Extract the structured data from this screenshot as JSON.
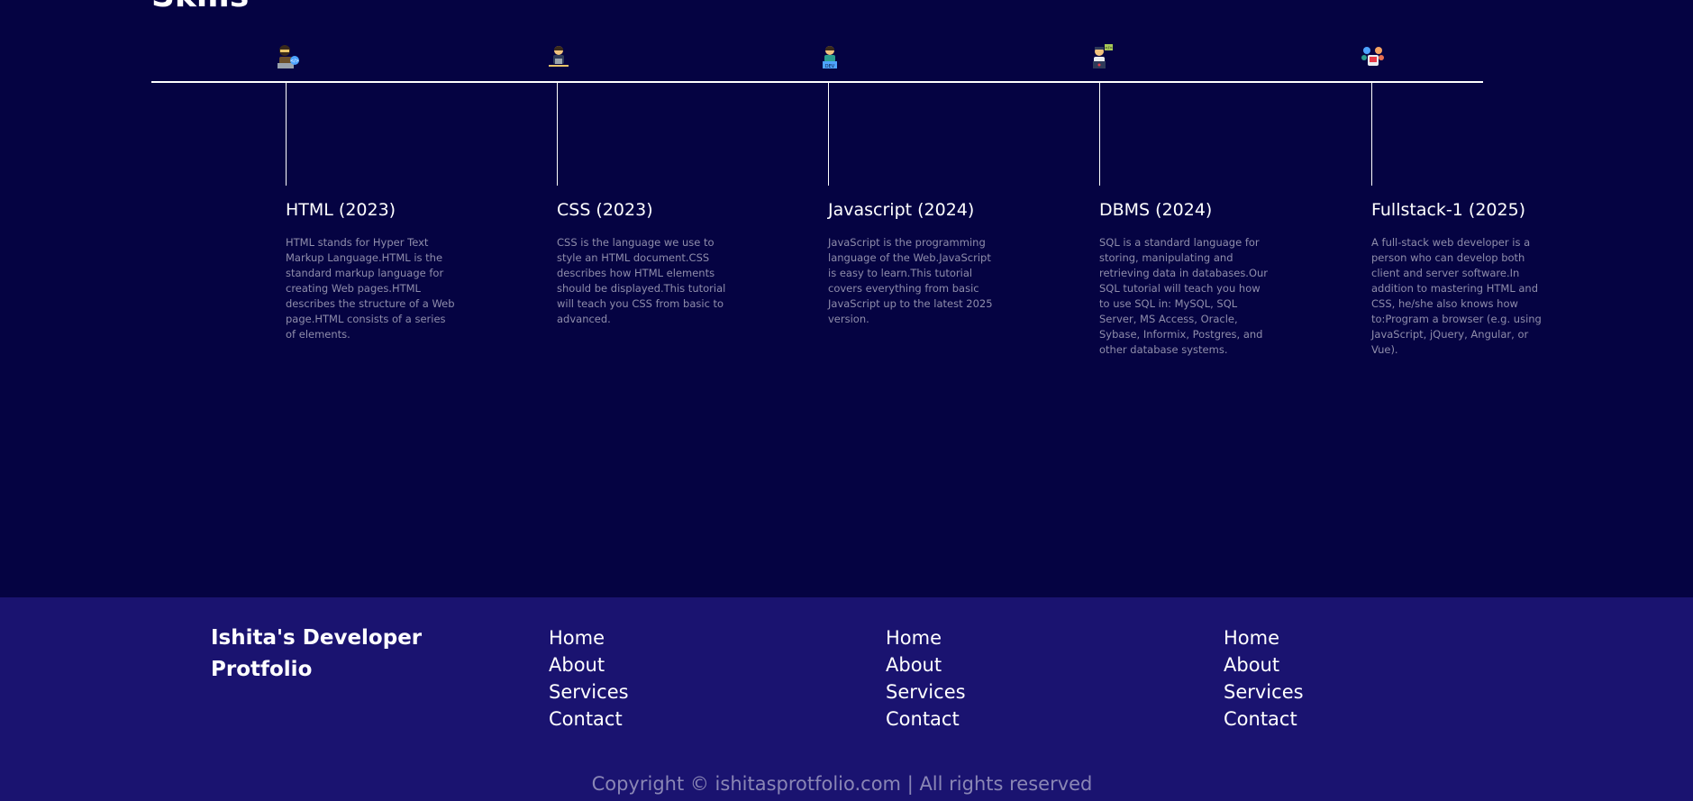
{
  "skills": {
    "title": "Skills",
    "items": [
      {
        "icon": "hacker-laptop-icon",
        "title": "HTML (2023)",
        "description": "HTML stands for Hyper Text Markup Language.HTML is the standard markup language for creating Web pages.HTML describes the structure of a Web page.HTML consists of a series of elements."
      },
      {
        "icon": "programmer-desk-icon",
        "title": "CSS (2023)",
        "description": "CSS is the language we use to style an HTML document.CSS describes how HTML elements should be displayed.This tutorial will teach you CSS from basic to advanced."
      },
      {
        "icon": "developer-dev-icon",
        "title": "Javascript (2024)",
        "description": "JavaScript is the programming language of the Web.JavaScript is easy to learn.This tutorial covers everything from basic JavaScript up to the latest 2025 version."
      },
      {
        "icon": "coder-code-tag-icon",
        "title": "DBMS (2024)",
        "description": "SQL is a standard language for storing, manipulating and retrieving data in databases.Our SQL tutorial will teach you how to use SQL in: MySQL, SQL Server, MS Access, Oracle, Sybase, Informix, Postgres, and other database systems."
      },
      {
        "icon": "fullstack-team-icon",
        "title": "Fullstack-1 (2025)",
        "description": "A full-stack web developer is a person who can develop both client and server software.In addition to mastering HTML and CSS, he/she also knows how to:Program a browser (e.g. using JavaScript, jQuery, Angular, or Vue)."
      }
    ]
  },
  "footer": {
    "brand": "Ishita's Developer Protfolio",
    "columns": [
      {
        "links": [
          "Home",
          "About",
          "Services",
          "Contact"
        ]
      },
      {
        "links": [
          "Home",
          "About",
          "Services",
          "Contact"
        ]
      },
      {
        "links": [
          "Home",
          "About",
          "Services",
          "Contact"
        ]
      }
    ],
    "copyright": "Copyright © ishitasprotfolio.com | All rights reserved"
  },
  "colors": {
    "page_background": "#050342",
    "footer_background": "#1a1370",
    "description_text": "#8f8dab",
    "copyright_text": "#8a86b5"
  }
}
